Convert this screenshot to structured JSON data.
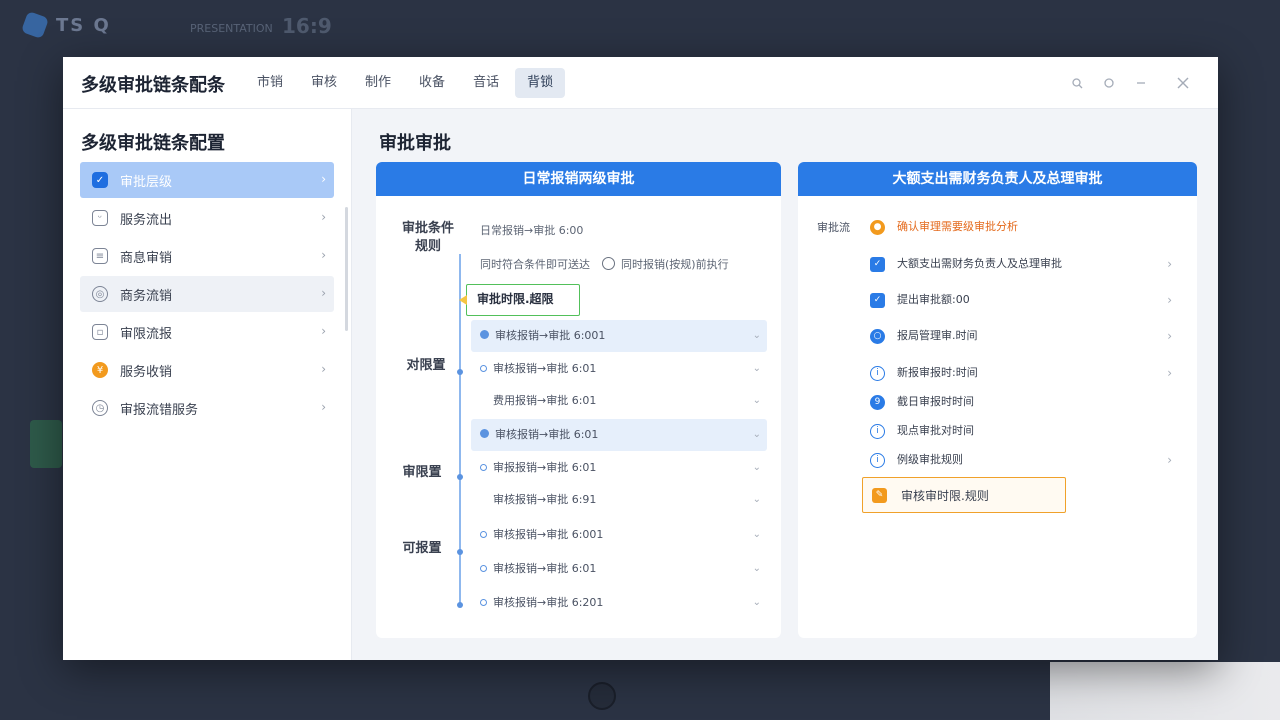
{
  "background": {
    "logo_text": "TS Q",
    "subtitle": "PRESENTATION",
    "ratio": "16:9"
  },
  "window": {
    "title": "多级审批链条配条",
    "menu": [
      "市销",
      "审核",
      "制作",
      "收备",
      "音话",
      "背锁"
    ],
    "active_menu_index": 5
  },
  "sidebar": {
    "title": "多级审批链条配置",
    "items": [
      {
        "label": "审批层级",
        "icon": "check-square-icon"
      },
      {
        "label": "服务流出",
        "icon": "face-box-icon"
      },
      {
        "label": "商息审销",
        "icon": "document-icon"
      },
      {
        "label": "商务流销",
        "icon": "target-icon"
      },
      {
        "label": "审限流报",
        "icon": "clipboard-icon"
      },
      {
        "label": "服务收销",
        "icon": "money-icon"
      },
      {
        "label": "审报流错服务",
        "icon": "clock-icon"
      }
    ],
    "active_index": 0,
    "hover_index": 3
  },
  "main": {
    "title": "审批审批",
    "left_panel": {
      "header": "日常报销两级审批",
      "first_group_label": "审批条件规则",
      "info_line_1": "日常报销→审批 6:00",
      "info_line_2_a": "同时符合条件即可送达",
      "info_line_2_b": "同时报销(按规)前执行",
      "timeout_tag": "审批时限.超限",
      "groups": [
        {
          "label": "对限置",
          "rows": [
            {
              "text": "审核报销→审批 6:001",
              "highlight": true
            },
            {
              "text": "审核报销→审批 6:01",
              "highlight": false
            },
            {
              "text": "费用报销→审批 6:01",
              "highlight": false
            }
          ]
        },
        {
          "label": "审限置",
          "rows": [
            {
              "text": "审核报销→审批 6:01",
              "highlight": true
            },
            {
              "text": "审报报销→审批 6:01",
              "highlight": false
            },
            {
              "text": "审核报销→审批 6:91",
              "highlight": false
            }
          ]
        },
        {
          "label": "可报置",
          "rows": [
            {
              "text": "审核报销→审批 6:001",
              "highlight": false
            },
            {
              "text": "审核报销→审批 6:01",
              "highlight": false
            },
            {
              "text": "审核报销→审批 6:201",
              "highlight": false
            }
          ]
        }
      ]
    },
    "right_panel": {
      "header": "大额支出需财务负责人及总理审批",
      "side_label": "审批流",
      "warning": "确认审理需要级审批分析",
      "rows": [
        {
          "text": "大额支出需财务负责人及总理审批",
          "icon": "check-icon",
          "chevron": true
        },
        {
          "text": "提出审批额:00",
          "icon": "check-icon",
          "chevron": true
        },
        {
          "text": "报局管理审.时间",
          "icon": "target-icon",
          "chevron": true
        },
        {
          "text": "新报审报时:时间",
          "icon": "info-circle-icon",
          "chevron": true
        },
        {
          "text": "截日审报时时间",
          "icon": "info-filled-icon",
          "chevron": false
        },
        {
          "text": "现点审批对时间",
          "icon": "info-circle-icon",
          "chevron": false
        },
        {
          "text": "例级审批规则",
          "icon": "info-circle-icon",
          "chevron": true
        }
      ],
      "orange_box": "审核审时限.规则"
    }
  },
  "colors": {
    "accent": "#2a7be6",
    "sidebar_active": "#a9c9f7",
    "warning": "#e46a1c",
    "success": "#52c05a"
  }
}
